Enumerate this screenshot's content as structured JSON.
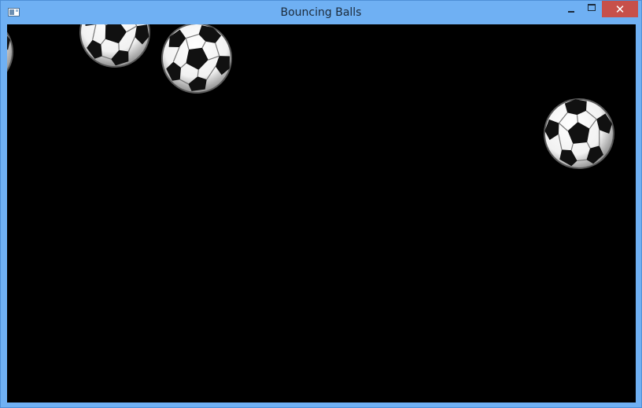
{
  "window": {
    "title": "Bouncing Balls",
    "controls": {
      "minimize_icon": "minimize-icon",
      "maximize_icon": "maximize-icon",
      "close_icon": "close-icon",
      "close_glyph": "✕"
    }
  },
  "canvas": {
    "background": "#000000",
    "balls": [
      {
        "name": "soccer-ball-edge-left"
      },
      {
        "name": "soccer-ball-1"
      },
      {
        "name": "soccer-ball-2"
      },
      {
        "name": "soccer-ball-3"
      }
    ]
  },
  "colors": {
    "titlebar": "#6fb0f3",
    "close_button": "#c7504a",
    "canvas": "#000000"
  }
}
